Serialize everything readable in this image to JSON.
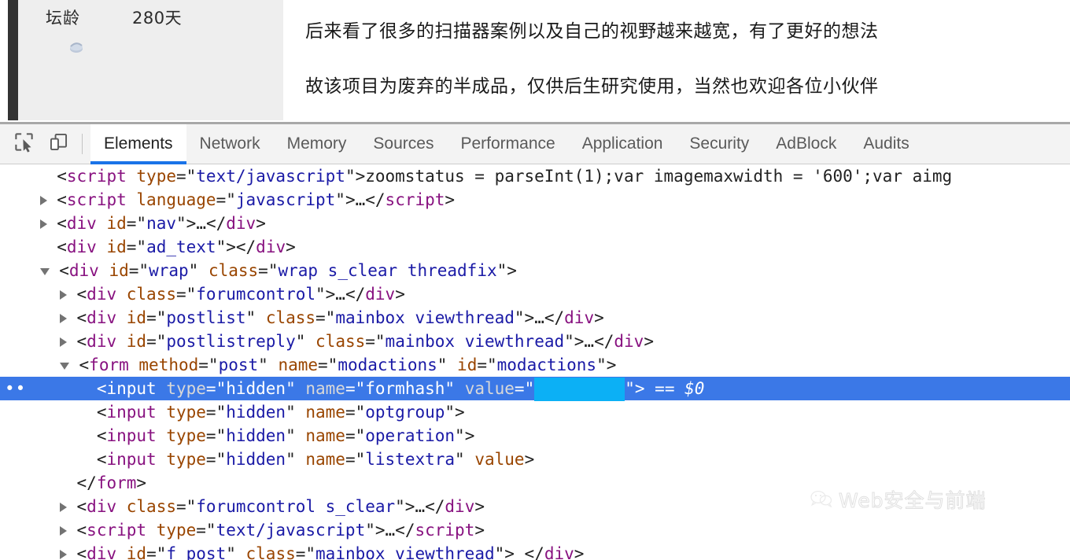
{
  "page": {
    "sidebar": {
      "stat_label": "坛龄",
      "stat_value": "280天",
      "medal_icon": "medal-icon"
    },
    "content": {
      "paragraph_1": "后来看了很多的扫描器案例以及自己的视野越来越宽，有了更好的想法",
      "paragraph_2": "故该项目为废弃的半成品，仅供后生研究使用，当然也欢迎各位小伙伴"
    }
  },
  "devtools": {
    "toolbar": {
      "inspect_icon": "inspect-element-icon",
      "device_icon": "device-toolbar-icon"
    },
    "tabs": [
      {
        "label": "Elements",
        "active": true
      },
      {
        "label": "Network",
        "active": false
      },
      {
        "label": "Memory",
        "active": false
      },
      {
        "label": "Sources",
        "active": false
      },
      {
        "label": "Performance",
        "active": false
      },
      {
        "label": "Application",
        "active": false
      },
      {
        "label": "Security",
        "active": false
      },
      {
        "label": "AdBlock",
        "active": false
      },
      {
        "label": "Audits",
        "active": false
      }
    ],
    "accent_color": "#1a73e8",
    "selection_color": "#3b78e7",
    "redaction_color": "#0cb0f5",
    "dom_lines": [
      {
        "indent": 1,
        "twisty": "none",
        "selected": false,
        "parts": [
          {
            "c": "punct",
            "t": "<"
          },
          {
            "c": "tag",
            "t": "script"
          },
          {
            "c": "punct",
            "t": " "
          },
          {
            "c": "attr",
            "t": "type"
          },
          {
            "c": "punct",
            "t": "=\""
          },
          {
            "c": "val",
            "t": "text/javascript"
          },
          {
            "c": "punct",
            "t": "\">"
          },
          {
            "c": "txtc",
            "t": "zoomstatus = parseInt(1);var imagemaxwidth = '600';var aimg"
          }
        ]
      },
      {
        "indent": 1,
        "twisty": "right",
        "selected": false,
        "parts": [
          {
            "c": "punct",
            "t": "<"
          },
          {
            "c": "tag",
            "t": "script"
          },
          {
            "c": "punct",
            "t": " "
          },
          {
            "c": "attr",
            "t": "language"
          },
          {
            "c": "punct",
            "t": "=\""
          },
          {
            "c": "val",
            "t": "javascript"
          },
          {
            "c": "punct",
            "t": "\">"
          },
          {
            "c": "txtc",
            "t": "…"
          },
          {
            "c": "punct",
            "t": "</"
          },
          {
            "c": "tag",
            "t": "script"
          },
          {
            "c": "punct",
            "t": ">"
          }
        ]
      },
      {
        "indent": 1,
        "twisty": "right",
        "selected": false,
        "parts": [
          {
            "c": "punct",
            "t": "<"
          },
          {
            "c": "tag",
            "t": "div"
          },
          {
            "c": "punct",
            "t": " "
          },
          {
            "c": "attr",
            "t": "id"
          },
          {
            "c": "punct",
            "t": "=\""
          },
          {
            "c": "val",
            "t": "nav"
          },
          {
            "c": "punct",
            "t": "\">"
          },
          {
            "c": "txtc",
            "t": "…"
          },
          {
            "c": "punct",
            "t": "</"
          },
          {
            "c": "tag",
            "t": "div"
          },
          {
            "c": "punct",
            "t": ">"
          }
        ]
      },
      {
        "indent": 1,
        "twisty": "none",
        "selected": false,
        "parts": [
          {
            "c": "punct",
            "t": "<"
          },
          {
            "c": "tag",
            "t": "div"
          },
          {
            "c": "punct",
            "t": " "
          },
          {
            "c": "attr",
            "t": "id"
          },
          {
            "c": "punct",
            "t": "=\""
          },
          {
            "c": "val",
            "t": "ad_text"
          },
          {
            "c": "punct",
            "t": "\"></"
          },
          {
            "c": "tag",
            "t": "div"
          },
          {
            "c": "punct",
            "t": ">"
          }
        ]
      },
      {
        "indent": 1,
        "twisty": "down",
        "selected": false,
        "parts": [
          {
            "c": "punct",
            "t": "<"
          },
          {
            "c": "tag",
            "t": "div"
          },
          {
            "c": "punct",
            "t": " "
          },
          {
            "c": "attr",
            "t": "id"
          },
          {
            "c": "punct",
            "t": "=\""
          },
          {
            "c": "val",
            "t": "wrap"
          },
          {
            "c": "punct",
            "t": "\" "
          },
          {
            "c": "attr",
            "t": "class"
          },
          {
            "c": "punct",
            "t": "=\""
          },
          {
            "c": "val",
            "t": "wrap s_clear threadfix"
          },
          {
            "c": "punct",
            "t": "\">"
          }
        ]
      },
      {
        "indent": 2,
        "twisty": "right",
        "selected": false,
        "parts": [
          {
            "c": "punct",
            "t": "<"
          },
          {
            "c": "tag",
            "t": "div"
          },
          {
            "c": "punct",
            "t": " "
          },
          {
            "c": "attr",
            "t": "class"
          },
          {
            "c": "punct",
            "t": "=\""
          },
          {
            "c": "val",
            "t": "forumcontrol"
          },
          {
            "c": "punct",
            "t": "\">"
          },
          {
            "c": "txtc",
            "t": "…"
          },
          {
            "c": "punct",
            "t": "</"
          },
          {
            "c": "tag",
            "t": "div"
          },
          {
            "c": "punct",
            "t": ">"
          }
        ]
      },
      {
        "indent": 2,
        "twisty": "right",
        "selected": false,
        "parts": [
          {
            "c": "punct",
            "t": "<"
          },
          {
            "c": "tag",
            "t": "div"
          },
          {
            "c": "punct",
            "t": " "
          },
          {
            "c": "attr",
            "t": "id"
          },
          {
            "c": "punct",
            "t": "=\""
          },
          {
            "c": "val",
            "t": "postlist"
          },
          {
            "c": "punct",
            "t": "\" "
          },
          {
            "c": "attr",
            "t": "class"
          },
          {
            "c": "punct",
            "t": "=\""
          },
          {
            "c": "val",
            "t": "mainbox viewthread"
          },
          {
            "c": "punct",
            "t": "\">"
          },
          {
            "c": "txtc",
            "t": "…"
          },
          {
            "c": "punct",
            "t": "</"
          },
          {
            "c": "tag",
            "t": "div"
          },
          {
            "c": "punct",
            "t": ">"
          }
        ]
      },
      {
        "indent": 2,
        "twisty": "right",
        "selected": false,
        "parts": [
          {
            "c": "punct",
            "t": "<"
          },
          {
            "c": "tag",
            "t": "div"
          },
          {
            "c": "punct",
            "t": " "
          },
          {
            "c": "attr",
            "t": "id"
          },
          {
            "c": "punct",
            "t": "=\""
          },
          {
            "c": "val",
            "t": "postlistreply"
          },
          {
            "c": "punct",
            "t": "\" "
          },
          {
            "c": "attr",
            "t": "class"
          },
          {
            "c": "punct",
            "t": "=\""
          },
          {
            "c": "val",
            "t": "mainbox viewthread"
          },
          {
            "c": "punct",
            "t": "\">"
          },
          {
            "c": "txtc",
            "t": "…"
          },
          {
            "c": "punct",
            "t": "</"
          },
          {
            "c": "tag",
            "t": "div"
          },
          {
            "c": "punct",
            "t": ">"
          }
        ]
      },
      {
        "indent": 2,
        "twisty": "down",
        "selected": false,
        "parts": [
          {
            "c": "punct",
            "t": "<"
          },
          {
            "c": "tag",
            "t": "form"
          },
          {
            "c": "punct",
            "t": " "
          },
          {
            "c": "attr",
            "t": "method"
          },
          {
            "c": "punct",
            "t": "=\""
          },
          {
            "c": "val",
            "t": "post"
          },
          {
            "c": "punct",
            "t": "\" "
          },
          {
            "c": "attr",
            "t": "name"
          },
          {
            "c": "punct",
            "t": "=\""
          },
          {
            "c": "val",
            "t": "modactions"
          },
          {
            "c": "punct",
            "t": "\" "
          },
          {
            "c": "attr",
            "t": "id"
          },
          {
            "c": "punct",
            "t": "=\""
          },
          {
            "c": "val",
            "t": "modactions"
          },
          {
            "c": "punct",
            "t": "\">"
          }
        ]
      },
      {
        "indent": 3,
        "twisty": "none",
        "selected": true,
        "redacted_value": true,
        "suffix": "== $0",
        "parts": [
          {
            "c": "punct",
            "t": "<"
          },
          {
            "c": "tag",
            "t": "input"
          },
          {
            "c": "punct",
            "t": " "
          },
          {
            "c": "attr",
            "t": "type"
          },
          {
            "c": "punct",
            "t": "=\""
          },
          {
            "c": "val",
            "t": "hidden"
          },
          {
            "c": "punct",
            "t": "\" "
          },
          {
            "c": "attr",
            "t": "name"
          },
          {
            "c": "punct",
            "t": "=\""
          },
          {
            "c": "val",
            "t": "formhash"
          },
          {
            "c": "punct",
            "t": "\" "
          },
          {
            "c": "attr",
            "t": "value"
          },
          {
            "c": "punct",
            "t": "=\""
          }
        ]
      },
      {
        "indent": 3,
        "twisty": "none",
        "selected": false,
        "parts": [
          {
            "c": "punct",
            "t": "<"
          },
          {
            "c": "tag",
            "t": "input"
          },
          {
            "c": "punct",
            "t": " "
          },
          {
            "c": "attr",
            "t": "type"
          },
          {
            "c": "punct",
            "t": "=\""
          },
          {
            "c": "val",
            "t": "hidden"
          },
          {
            "c": "punct",
            "t": "\" "
          },
          {
            "c": "attr",
            "t": "name"
          },
          {
            "c": "punct",
            "t": "=\""
          },
          {
            "c": "val",
            "t": "optgroup"
          },
          {
            "c": "punct",
            "t": "\">"
          }
        ]
      },
      {
        "indent": 3,
        "twisty": "none",
        "selected": false,
        "parts": [
          {
            "c": "punct",
            "t": "<"
          },
          {
            "c": "tag",
            "t": "input"
          },
          {
            "c": "punct",
            "t": " "
          },
          {
            "c": "attr",
            "t": "type"
          },
          {
            "c": "punct",
            "t": "=\""
          },
          {
            "c": "val",
            "t": "hidden"
          },
          {
            "c": "punct",
            "t": "\" "
          },
          {
            "c": "attr",
            "t": "name"
          },
          {
            "c": "punct",
            "t": "=\""
          },
          {
            "c": "val",
            "t": "operation"
          },
          {
            "c": "punct",
            "t": "\">"
          }
        ]
      },
      {
        "indent": 3,
        "twisty": "none",
        "selected": false,
        "parts": [
          {
            "c": "punct",
            "t": "<"
          },
          {
            "c": "tag",
            "t": "input"
          },
          {
            "c": "punct",
            "t": " "
          },
          {
            "c": "attr",
            "t": "type"
          },
          {
            "c": "punct",
            "t": "=\""
          },
          {
            "c": "val",
            "t": "hidden"
          },
          {
            "c": "punct",
            "t": "\" "
          },
          {
            "c": "attr",
            "t": "name"
          },
          {
            "c": "punct",
            "t": "=\""
          },
          {
            "c": "val",
            "t": "listextra"
          },
          {
            "c": "punct",
            "t": "\" "
          },
          {
            "c": "attr",
            "t": "value"
          },
          {
            "c": "punct",
            "t": ">"
          }
        ]
      },
      {
        "indent": 2,
        "twisty": "none",
        "selected": false,
        "parts": [
          {
            "c": "punct",
            "t": "</"
          },
          {
            "c": "tag",
            "t": "form"
          },
          {
            "c": "punct",
            "t": ">"
          }
        ]
      },
      {
        "indent": 2,
        "twisty": "right",
        "selected": false,
        "parts": [
          {
            "c": "punct",
            "t": "<"
          },
          {
            "c": "tag",
            "t": "div"
          },
          {
            "c": "punct",
            "t": " "
          },
          {
            "c": "attr",
            "t": "class"
          },
          {
            "c": "punct",
            "t": "=\""
          },
          {
            "c": "val",
            "t": "forumcontrol s_clear"
          },
          {
            "c": "punct",
            "t": "\">"
          },
          {
            "c": "txtc",
            "t": "…"
          },
          {
            "c": "punct",
            "t": "</"
          },
          {
            "c": "tag",
            "t": "div"
          },
          {
            "c": "punct",
            "t": ">"
          }
        ]
      },
      {
        "indent": 2,
        "twisty": "right",
        "selected": false,
        "parts": [
          {
            "c": "punct",
            "t": "<"
          },
          {
            "c": "tag",
            "t": "script"
          },
          {
            "c": "punct",
            "t": " "
          },
          {
            "c": "attr",
            "t": "type"
          },
          {
            "c": "punct",
            "t": "=\""
          },
          {
            "c": "val",
            "t": "text/javascript"
          },
          {
            "c": "punct",
            "t": "\">"
          },
          {
            "c": "txtc",
            "t": "…"
          },
          {
            "c": "punct",
            "t": "</"
          },
          {
            "c": "tag",
            "t": "script"
          },
          {
            "c": "punct",
            "t": ">"
          }
        ]
      },
      {
        "indent": 2,
        "twisty": "right",
        "selected": false,
        "parts": [
          {
            "c": "punct",
            "t": "<"
          },
          {
            "c": "tag",
            "t": "div"
          },
          {
            "c": "punct",
            "t": " "
          },
          {
            "c": "attr",
            "t": "id"
          },
          {
            "c": "punct",
            "t": "=\""
          },
          {
            "c": "val",
            "t": "f_post"
          },
          {
            "c": "punct",
            "t": "\" "
          },
          {
            "c": "attr",
            "t": "class"
          },
          {
            "c": "punct",
            "t": "=\""
          },
          {
            "c": "val",
            "t": "mainbox viewthread"
          },
          {
            "c": "punct",
            "t": "\"> </"
          },
          {
            "c": "tag",
            "t": "div"
          },
          {
            "c": "punct",
            "t": ">"
          }
        ]
      }
    ]
  },
  "watermark": {
    "icon": "wechat-icon",
    "text": "Web安全与前端"
  }
}
